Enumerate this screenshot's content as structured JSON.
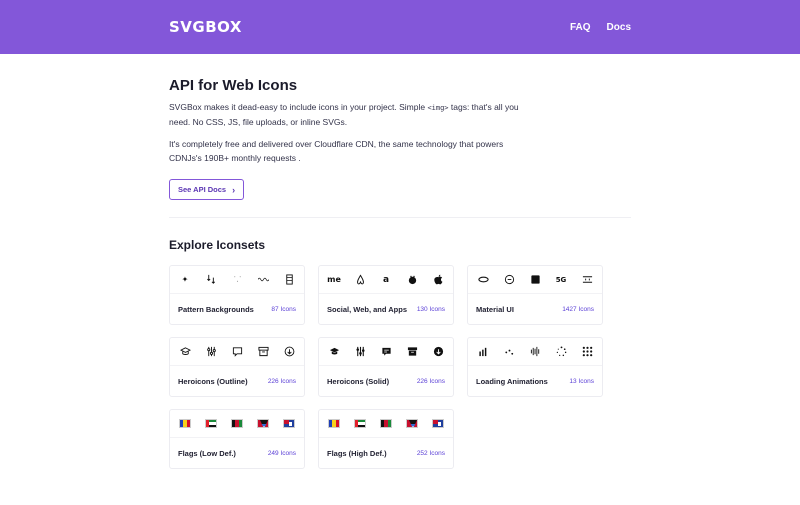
{
  "header": {
    "logo": "SVGBOX",
    "nav": [
      "FAQ",
      "Docs"
    ]
  },
  "hero": {
    "title": "API for Web Icons",
    "p1_before": "SVGBox makes it dead-easy to include icons in your project. Simple ",
    "p1_code": "<img>",
    "p1_after": " tags: that's all you need. No CSS, JS, file uploads, or inline SVGs.",
    "p2": "It's completely free and delivered over Cloudflare CDN, the same technology that powers CDNJs's 190B+ monthly requests .",
    "button": "See API Docs"
  },
  "section": {
    "title": "Explore Iconsets"
  },
  "iconsets": [
    {
      "name": "Pattern Backgrounds",
      "count": "87 Icons",
      "icons": [
        "sparkle-icon",
        "arrows-down-icon",
        "dots-icon",
        "wave-icon",
        "grid-icon"
      ]
    },
    {
      "name": "Social, Web, and Apps",
      "count": "130 Icons",
      "icons": [
        "meetup-icon",
        "airbnb-icon",
        "amazon-icon",
        "airfrance-icon",
        "apple-icon"
      ]
    },
    {
      "name": "Material UI",
      "count": "1427 Icons",
      "icons": [
        "threesixty-icon",
        "rotate-icon",
        "tenk-icon",
        "fiveg-icon",
        "sixtyfps-icon"
      ]
    },
    {
      "name": "Heroicons (Outline)",
      "count": "226 Icons",
      "icons": [
        "academic-cap-icon",
        "adjustments-icon",
        "annotation-icon",
        "archive-icon",
        "arrow-circle-down-icon"
      ]
    },
    {
      "name": "Heroicons (Solid)",
      "count": "226 Icons",
      "icons": [
        "academic-cap-icon",
        "adjustments-icon",
        "annotation-icon",
        "archive-icon",
        "arrow-circle-down-icon"
      ]
    },
    {
      "name": "Loading Animations",
      "count": "13 Icons",
      "icons": [
        "bars-icon",
        "dots-scatter-icon",
        "audio-icon",
        "ball-triangle-icon",
        "grid-dots-icon"
      ]
    },
    {
      "name": "Flags (Low Def.)",
      "count": "249 Icons",
      "icons": [
        "flag-ad-icon",
        "flag-ae-icon",
        "flag-af-icon",
        "flag-ag-icon",
        "flag-ai-icon"
      ]
    },
    {
      "name": "Flags (High Def.)",
      "count": "252 Icons",
      "icons": [
        "flag-ad-icon",
        "flag-ae-icon",
        "flag-af-icon",
        "flag-ag-icon",
        "flag-ai-icon"
      ]
    }
  ],
  "colors": {
    "brand": "#8357d9",
    "count_text": "#5a3fd6"
  }
}
